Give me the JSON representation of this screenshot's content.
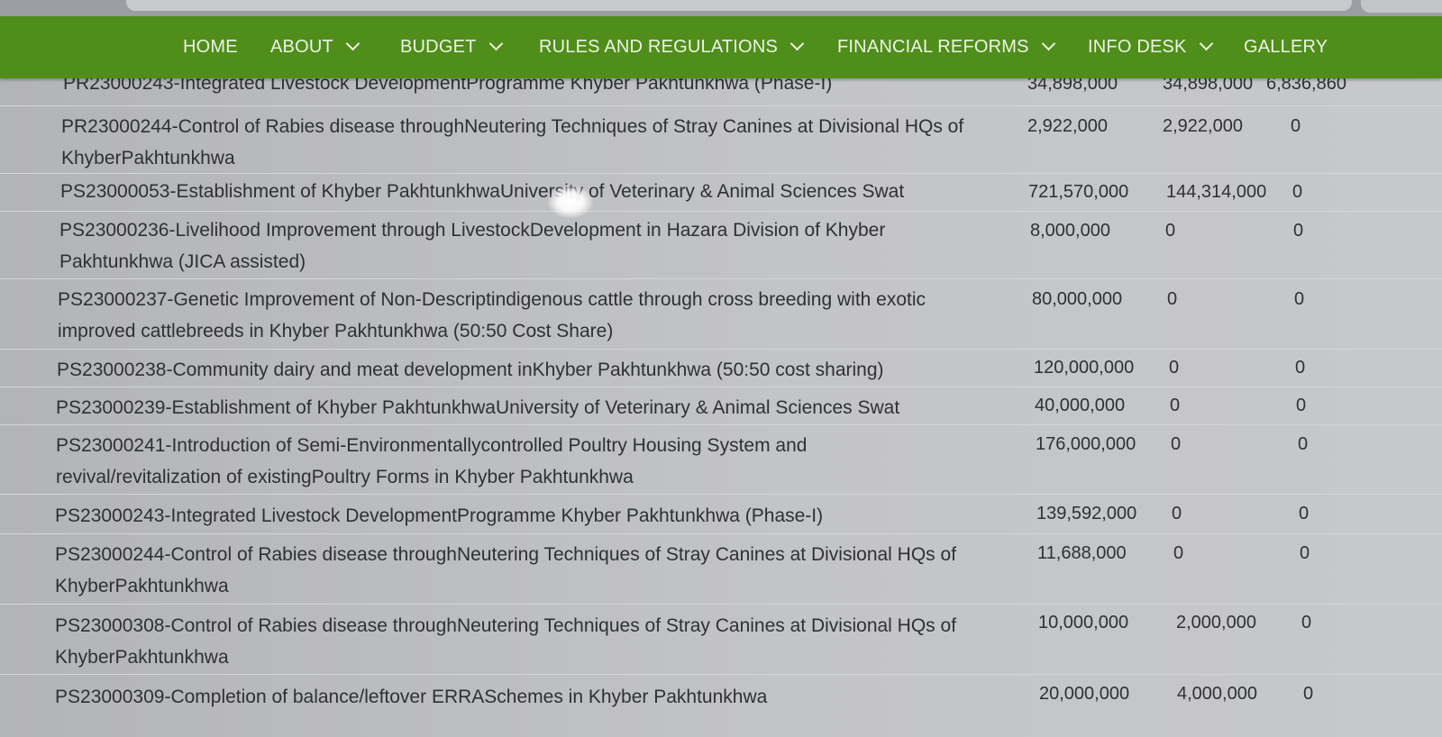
{
  "nav": {
    "home": "HOME",
    "about": "ABOUT",
    "budget": "BUDGET",
    "rules": "RULES AND REGULATIONS",
    "financial_reforms": "FINANCIAL REFORMS",
    "info_desk": "INFO DESK",
    "gallery": "GALLERY"
  },
  "colors": {
    "nav_bg": "#4f8e1a",
    "nav_text": "#eef3e6",
    "table_bg": "#c3c4c6"
  },
  "rows": [
    {
      "line1": "PR23000243-Integrated Livestock DevelopmentProgramme Khyber Pakhtunkhwa (Phase-I)",
      "line2": "",
      "v1": "34,898,000",
      "v2": "34,898,000",
      "v3": "6,836,860"
    },
    {
      "line1": "PR23000244-Control of Rabies disease throughNeutering Techniques of Stray Canines at Divisional HQs of",
      "line2": "KhyberPakhtunkhwa",
      "v1": "2,922,000",
      "v2": "2,922,000",
      "v3": "0"
    },
    {
      "line1": "PS23000053-Establishment of Khyber PakhtunkhwaUniversity of Veterinary & Animal Sciences Swat",
      "line2": "",
      "v1": "721,570,000",
      "v2": "144,314,000",
      "v3": "0"
    },
    {
      "line1": "PS23000236-Livelihood Improvement through LivestockDevelopment in Hazara Division of Khyber",
      "line2": "Pakhtunkhwa (JICA assisted)",
      "v1": "8,000,000",
      "v2": "0",
      "v3": "0"
    },
    {
      "line1": "PS23000237-Genetic Improvement of Non-Descriptindigenous cattle through cross breeding with exotic",
      "line2": "improved cattlebreeds in Khyber Pakhtunkhwa (50:50 Cost Share)",
      "v1": "80,000,000",
      "v2": "0",
      "v3": "0"
    },
    {
      "line1": "PS23000238-Community dairy and meat development inKhyber Pakhtunkhwa (50:50 cost sharing)",
      "line2": "",
      "v1": "120,000,000",
      "v2": "0",
      "v3": "0"
    },
    {
      "line1": "PS23000239-Establishment of Khyber PakhtunkhwaUniversity of Veterinary & Animal Sciences Swat",
      "line2": "",
      "v1": "40,000,000",
      "v2": "0",
      "v3": "0"
    },
    {
      "line1": "PS23000241-Introduction of Semi-Environmentallycontrolled Poultry Housing System and",
      "line2": "revival/revitalization of existingPoultry Forms in Khyber Pakhtunkhwa",
      "v1": "176,000,000",
      "v2": "0",
      "v3": "0"
    },
    {
      "line1": "PS23000243-Integrated Livestock DevelopmentProgramme Khyber Pakhtunkhwa (Phase-I)",
      "line2": "",
      "v1": "139,592,000",
      "v2": "0",
      "v3": "0"
    },
    {
      "line1": "PS23000244-Control of Rabies disease throughNeutering Techniques of Stray Canines at Divisional HQs of",
      "line2": "KhyberPakhtunkhwa",
      "v1": "11,688,000",
      "v2": "0",
      "v3": "0"
    },
    {
      "line1": "PS23000308-Control of Rabies disease throughNeutering Techniques of Stray Canines at Divisional HQs of",
      "line2": "KhyberPakhtunkhwa",
      "v1": "10,000,000",
      "v2": "2,000,000",
      "v3": "0"
    },
    {
      "line1": "PS23000309-Completion of balance/leftover ERRASchemes in Khyber Pakhtunkhwa",
      "line2": "",
      "v1": "20,000,000",
      "v2": "4,000,000",
      "v3": "0"
    }
  ]
}
